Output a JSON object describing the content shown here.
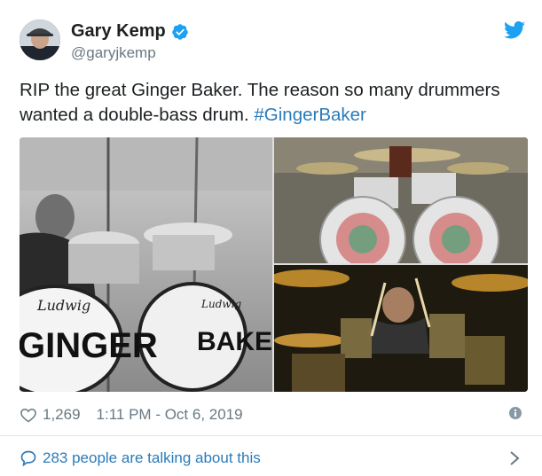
{
  "author": {
    "display_name": "Gary Kemp",
    "handle": "@garyjkemp",
    "verified": true
  },
  "tweet": {
    "text_plain": "RIP the great Ginger Baker. The reason so many drummers wanted a double-bass drum. ",
    "hashtag": "#GingerBaker"
  },
  "media": {
    "photo_left_drum_text_top": "Ludwig",
    "photo_left_drum_text_main": "GINGER",
    "photo_left_drum2_text_top": "Ludwig",
    "photo_left_drum2_text_main": "BAKER"
  },
  "meta": {
    "likes": "1,269",
    "timestamp": "1:11 PM - Oct 6, 2019"
  },
  "footer": {
    "talking_label": "283 people are talking about this"
  },
  "colors": {
    "link": "#2b7bb9",
    "verified": "#1da1f2",
    "secondary_text": "#697882",
    "divider": "#e1e8ed"
  },
  "icons": [
    "verified-badge-icon",
    "twitter-bird-icon",
    "heart-icon",
    "info-icon",
    "speech-bubble-icon",
    "chevron-right-icon"
  ]
}
